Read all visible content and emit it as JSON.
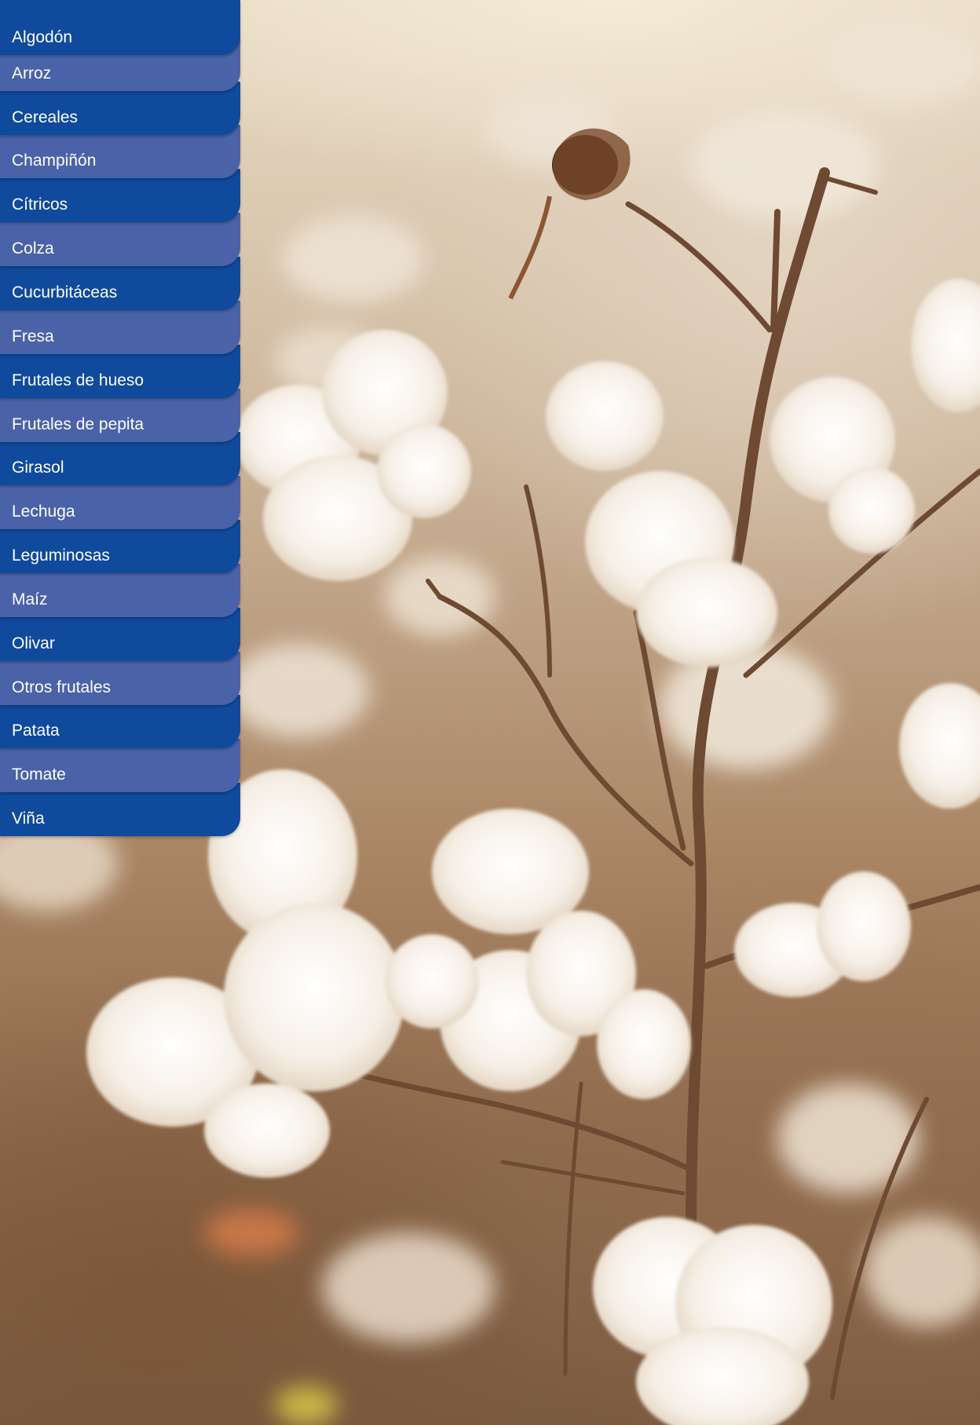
{
  "background": {
    "icon": "cotton-field-photo"
  },
  "colors": {
    "item_dark": "#0f4a9c",
    "item_light": "#4a62a8",
    "text": "#ffffff"
  },
  "menu": {
    "items": [
      {
        "label": "Algodón"
      },
      {
        "label": "Arroz"
      },
      {
        "label": "Cereales"
      },
      {
        "label": "Champiñón"
      },
      {
        "label": "Cítricos"
      },
      {
        "label": "Colza"
      },
      {
        "label": "Cucurbitáceas"
      },
      {
        "label": "Fresa"
      },
      {
        "label": "Frutales de hueso"
      },
      {
        "label": "Frutales de pepita"
      },
      {
        "label": "Girasol"
      },
      {
        "label": "Lechuga"
      },
      {
        "label": "Leguminosas"
      },
      {
        "label": "Maíz"
      },
      {
        "label": "Olivar"
      },
      {
        "label": "Otros frutales"
      },
      {
        "label": "Patata"
      },
      {
        "label": "Tomate"
      },
      {
        "label": "Viña"
      }
    ]
  }
}
